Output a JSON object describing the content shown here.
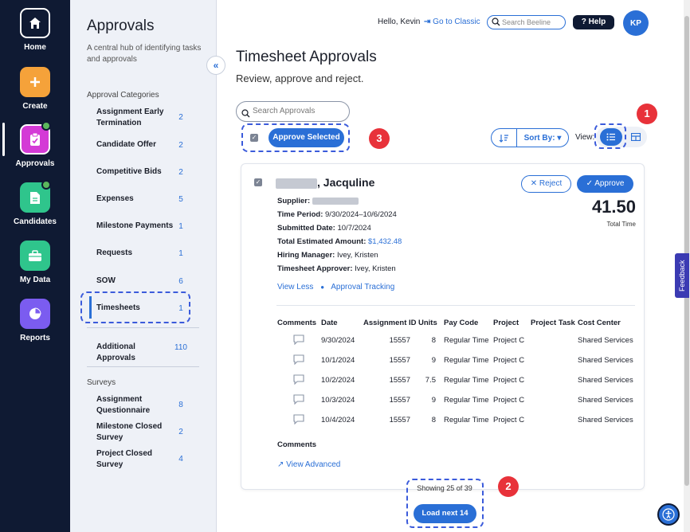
{
  "nav": {
    "items": [
      {
        "label": "Home",
        "icon": "home-icon",
        "color": "#0f1a33"
      },
      {
        "label": "Create",
        "icon": "plus-icon",
        "color": "#f5a23a"
      },
      {
        "label": "Approvals",
        "icon": "clipboard-check-icon",
        "color": "#d43ad6"
      },
      {
        "label": "Candidates",
        "icon": "document-icon",
        "color": "#2fc58c"
      },
      {
        "label": "My Data",
        "icon": "briefcase-icon",
        "color": "#2fc58c"
      },
      {
        "label": "Reports",
        "icon": "pie-chart-icon",
        "color": "#7b5cf0"
      }
    ]
  },
  "panel": {
    "title": "Approvals",
    "description": "A central hub of identifying tasks and approvals",
    "categories_heading": "Approval Categories",
    "categories": [
      {
        "label": "Assignment Early Termination",
        "count": "2"
      },
      {
        "label": "Candidate Offer",
        "count": "2"
      },
      {
        "label": "Competitive Bids",
        "count": "2"
      },
      {
        "label": "Expenses",
        "count": "5"
      },
      {
        "label": "Milestone Payments",
        "count": "1"
      },
      {
        "label": "Requests",
        "count": "1"
      },
      {
        "label": "SOW",
        "count": "6"
      },
      {
        "label": "Timesheets",
        "count": "1"
      }
    ],
    "additional": {
      "label": "Additional Approvals",
      "count": "110"
    },
    "surveys_heading": "Surveys",
    "surveys": [
      {
        "label": "Assignment Questionnaire",
        "count": "8"
      },
      {
        "label": "Milestone Closed Survey",
        "count": "2"
      },
      {
        "label": "Project Closed Survey",
        "count": "4"
      }
    ]
  },
  "header": {
    "greeting": "Hello, Kevin",
    "classic_link": "Go to Classic",
    "search_placeholder": "Search Beeline",
    "help_label": "Help",
    "avatar_initials": "KP"
  },
  "main": {
    "title": "Timesheet Approvals",
    "subtitle": "Review, approve and reject.",
    "search_placeholder": "Search Approvals",
    "approve_selected": "Approve Selected",
    "sort_label": "Sort By:",
    "view_label": "View:"
  },
  "card": {
    "name_suffix": ", Jacquline",
    "supplier_label": "Supplier:",
    "time_period_label": "Time Period:",
    "time_period": "9/30/2024–10/6/2024",
    "submitted_label": "Submitted Date:",
    "submitted": "10/7/2024",
    "total_label": "Total Estimated Amount:",
    "total": "$1,432.48",
    "hiring_label": "Hiring Manager:",
    "hiring": "Ivey, Kristen",
    "approver_label": "Timesheet Approver:",
    "approver": "Ivey, Kristen",
    "view_less": "View Less",
    "approval_tracking": "Approval Tracking",
    "reject": "Reject",
    "approve": "Approve",
    "hours": "41.50",
    "hours_label": "Total Time",
    "columns": [
      "Comments",
      "Date",
      "Assignment ID",
      "Units",
      "Pay Code",
      "Project",
      "Project Task",
      "Cost Center"
    ],
    "rows": [
      {
        "date": "9/30/2024",
        "aid": "15557",
        "units": "8",
        "pay": "Regular Time",
        "project": "Project C",
        "task": "",
        "cc": "Shared Services"
      },
      {
        "date": "10/1/2024",
        "aid": "15557",
        "units": "9",
        "pay": "Regular Time",
        "project": "Project C",
        "task": "",
        "cc": "Shared Services"
      },
      {
        "date": "10/2/2024",
        "aid": "15557",
        "units": "7.5",
        "pay": "Regular Time",
        "project": "Project C",
        "task": "",
        "cc": "Shared Services"
      },
      {
        "date": "10/3/2024",
        "aid": "15557",
        "units": "9",
        "pay": "Regular Time",
        "project": "Project C",
        "task": "",
        "cc": "Shared Services"
      },
      {
        "date": "10/4/2024",
        "aid": "15557",
        "units": "8",
        "pay": "Regular Time",
        "project": "Project C",
        "task": "",
        "cc": "Shared Services"
      }
    ],
    "comments_label": "Comments",
    "view_advanced": "View Advanced"
  },
  "pagination": {
    "showing": "Showing 25 of 39",
    "load_next": "Load next 14"
  },
  "callouts": [
    "1",
    "2",
    "3"
  ],
  "feedback": "Feedback",
  "colors": {
    "accent": "#2a6fd6",
    "nav_bg": "#0f1a33",
    "callout": "#e8323a",
    "highlight": "#3b5bdb"
  }
}
